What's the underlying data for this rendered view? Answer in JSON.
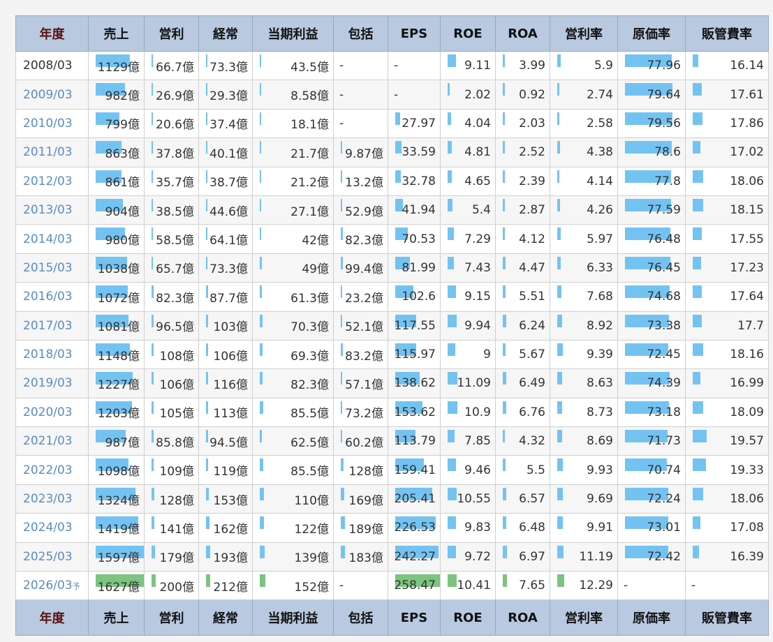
{
  "headers": [
    "年度",
    "売上",
    "営利",
    "経常",
    "当期利益",
    "包括",
    "EPS",
    "ROE",
    "ROA",
    "営利率",
    "原価率",
    "販管費率"
  ],
  "colors": {
    "header_bg": "#b8c9e0",
    "bar_actual": "#73c3f2",
    "bar_forecast": "#7cc47f",
    "year_link": "#5a8bc3"
  },
  "forecast_mark": "予",
  "rows": [
    {
      "year": "2008/03",
      "sales": "1129億",
      "op": "66.7億",
      "ord": "73.3億",
      "net": "43.5億",
      "comp": "-",
      "eps": "-",
      "roe": "9.11",
      "roa": "3.99",
      "opm": "5.9",
      "cogs": "77.96",
      "sga": "16.14"
    },
    {
      "year": "2009/03",
      "sales": "982億",
      "op": "26.9億",
      "ord": "29.3億",
      "net": "8.58億",
      "comp": "-",
      "eps": "-",
      "roe": "2.02",
      "roa": "0.92",
      "opm": "2.74",
      "cogs": "79.64",
      "sga": "17.61"
    },
    {
      "year": "2010/03",
      "sales": "799億",
      "op": "20.6億",
      "ord": "37.4億",
      "net": "18.1億",
      "comp": "-",
      "eps": "27.97",
      "roe": "4.04",
      "roa": "2.03",
      "opm": "2.58",
      "cogs": "79.56",
      "sga": "17.86"
    },
    {
      "year": "2011/03",
      "sales": "863億",
      "op": "37.8億",
      "ord": "40.1億",
      "net": "21.7億",
      "comp": "9.87億",
      "eps": "33.59",
      "roe": "4.81",
      "roa": "2.52",
      "opm": "4.38",
      "cogs": "78.6",
      "sga": "17.02"
    },
    {
      "year": "2012/03",
      "sales": "861億",
      "op": "35.7億",
      "ord": "38.7億",
      "net": "21.2億",
      "comp": "13.2億",
      "eps": "32.78",
      "roe": "4.65",
      "roa": "2.39",
      "opm": "4.14",
      "cogs": "77.8",
      "sga": "18.06"
    },
    {
      "year": "2013/03",
      "sales": "904億",
      "op": "38.5億",
      "ord": "44.6億",
      "net": "27.1億",
      "comp": "52.9億",
      "eps": "41.94",
      "roe": "5.4",
      "roa": "2.87",
      "opm": "4.26",
      "cogs": "77.59",
      "sga": "18.15"
    },
    {
      "year": "2014/03",
      "sales": "980億",
      "op": "58.5億",
      "ord": "64.1億",
      "net": "42億",
      "comp": "82.3億",
      "eps": "70.53",
      "roe": "7.29",
      "roa": "4.12",
      "opm": "5.97",
      "cogs": "76.48",
      "sga": "17.55"
    },
    {
      "year": "2015/03",
      "sales": "1038億",
      "op": "65.7億",
      "ord": "73.3億",
      "net": "49億",
      "comp": "99.4億",
      "eps": "81.99",
      "roe": "7.43",
      "roa": "4.47",
      "opm": "6.33",
      "cogs": "76.45",
      "sga": "17.23"
    },
    {
      "year": "2016/03",
      "sales": "1072億",
      "op": "82.3億",
      "ord": "87.7億",
      "net": "61.3億",
      "comp": "23.2億",
      "eps": "102.6",
      "roe": "9.15",
      "roa": "5.51",
      "opm": "7.68",
      "cogs": "74.68",
      "sga": "17.64"
    },
    {
      "year": "2017/03",
      "sales": "1081億",
      "op": "96.5億",
      "ord": "103億",
      "net": "70.3億",
      "comp": "52.1億",
      "eps": "117.55",
      "roe": "9.94",
      "roa": "6.24",
      "opm": "8.92",
      "cogs": "73.38",
      "sga": "17.7"
    },
    {
      "year": "2018/03",
      "sales": "1148億",
      "op": "108億",
      "ord": "106億",
      "net": "69.3億",
      "comp": "83.2億",
      "eps": "115.97",
      "roe": "9",
      "roa": "5.67",
      "opm": "9.39",
      "cogs": "72.45",
      "sga": "18.16"
    },
    {
      "year": "2019/03",
      "sales": "1227億",
      "op": "106億",
      "ord": "116億",
      "net": "82.3億",
      "comp": "57.1億",
      "eps": "138.62",
      "roe": "11.09",
      "roa": "6.49",
      "opm": "8.63",
      "cogs": "74.39",
      "sga": "16.99"
    },
    {
      "year": "2020/03",
      "sales": "1203億",
      "op": "105億",
      "ord": "113億",
      "net": "85.5億",
      "comp": "73.2億",
      "eps": "153.62",
      "roe": "10.9",
      "roa": "6.76",
      "opm": "8.73",
      "cogs": "73.18",
      "sga": "18.09"
    },
    {
      "year": "2021/03",
      "sales": "987億",
      "op": "85.8億",
      "ord": "94.5億",
      "net": "62.5億",
      "comp": "60.2億",
      "eps": "113.79",
      "roe": "7.85",
      "roa": "4.32",
      "opm": "8.69",
      "cogs": "71.73",
      "sga": "19.57"
    },
    {
      "year": "2022/03",
      "sales": "1098億",
      "op": "109億",
      "ord": "119億",
      "net": "85.5億",
      "comp": "128億",
      "eps": "159.41",
      "roe": "9.46",
      "roa": "5.5",
      "opm": "9.93",
      "cogs": "70.74",
      "sga": "19.33"
    },
    {
      "year": "2023/03",
      "sales": "1324億",
      "op": "128億",
      "ord": "153億",
      "net": "110億",
      "comp": "169億",
      "eps": "205.41",
      "roe": "10.55",
      "roa": "6.57",
      "opm": "9.69",
      "cogs": "72.24",
      "sga": "18.06"
    },
    {
      "year": "2024/03",
      "sales": "1419億",
      "op": "141億",
      "ord": "162億",
      "net": "122億",
      "comp": "189億",
      "eps": "226.53",
      "roe": "9.83",
      "roa": "6.48",
      "opm": "9.91",
      "cogs": "73.01",
      "sga": "17.08"
    },
    {
      "year": "2025/03",
      "sales": "1597億",
      "op": "179億",
      "ord": "193億",
      "net": "139億",
      "comp": "183億",
      "eps": "242.27",
      "roe": "9.72",
      "roa": "6.97",
      "opm": "11.19",
      "cogs": "72.42",
      "sga": "16.39"
    },
    {
      "year": "2026/03",
      "forecast": true,
      "sales": "1627億",
      "op": "200億",
      "ord": "212億",
      "net": "152億",
      "comp": "-",
      "eps": "258.47",
      "roe": "10.41",
      "roa": "7.65",
      "opm": "12.29",
      "cogs": "-",
      "sga": "-"
    }
  ]
}
